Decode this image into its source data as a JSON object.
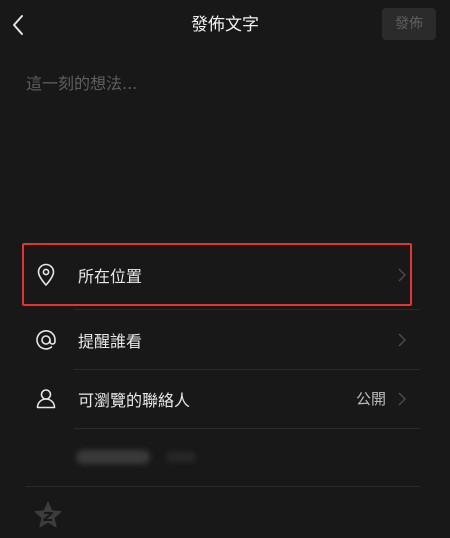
{
  "header": {
    "title": "發佈文字",
    "publish_label": "發佈"
  },
  "compose": {
    "placeholder": "這一刻的想法...",
    "value": ""
  },
  "options": [
    {
      "label": "所在位置",
      "icon": "location-pin-icon",
      "value": ""
    },
    {
      "label": "提醒誰看",
      "icon": "at-sign-icon",
      "value": ""
    },
    {
      "label": "可瀏覽的聯絡人",
      "icon": "person-icon",
      "value": "公開"
    }
  ],
  "colors": {
    "background": "#181818",
    "highlight": "#e0362d",
    "text": "#e8e8e8",
    "placeholder": "#5f5f5f",
    "disabled_button": "#2b2b2b"
  }
}
